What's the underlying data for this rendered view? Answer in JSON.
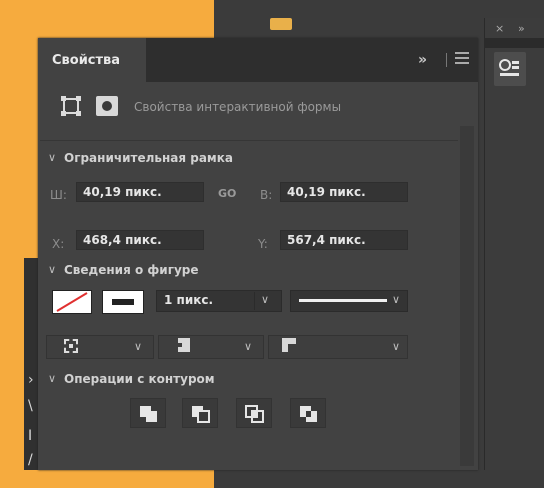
{
  "panel": {
    "tab_label": "Свойства",
    "more_label": "»",
    "close_label": "×",
    "collapse_label": "»"
  },
  "shape_properties": {
    "label": "Свойства интерактивной формы"
  },
  "bounding_box": {
    "title": "Ограничительная рамка",
    "width_label": "Ш:",
    "width_value": "40,19 пикс.",
    "link_label": "GO",
    "height_label": "В:",
    "height_value": "40,19 пикс.",
    "x_label": "X:",
    "x_value": "468,4 пикс.",
    "y_label": "Y:",
    "y_value": "567,4 пикс."
  },
  "shape_info": {
    "title": "Сведения о фигуре",
    "stroke_width": "1 пикс."
  },
  "path_operations": {
    "title": "Операции с контуром",
    "buttons": [
      "combine-shapes",
      "subtract-front-shape",
      "intersect-shape-areas",
      "exclude-overlapping-shapes"
    ]
  },
  "colors": {
    "accent_orange": "#f6ab3e",
    "panel_bg": "#424242",
    "field_bg": "#343434",
    "text": "#e6e6e6"
  }
}
